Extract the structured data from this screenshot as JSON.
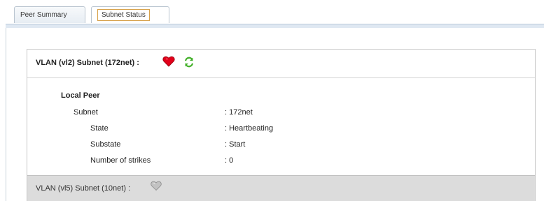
{
  "tabs": {
    "peer_summary": "Peer Summary",
    "subnet_status": "Subnet Status"
  },
  "vlan1": {
    "title": "VLAN (vl2) Subnet (172net) :",
    "status_icon": "heart-red-icon",
    "refresh_icon": "refresh-green-icon",
    "section_title": "Local Peer",
    "rows": [
      {
        "label": "Subnet",
        "value": ": 172net"
      },
      {
        "label": "State",
        "value": ": Heartbeating"
      },
      {
        "label": "Substate",
        "value": ": Start"
      },
      {
        "label": "Number of strikes",
        "value": ": 0"
      }
    ]
  },
  "vlan2": {
    "title": "VLAN (vl5) Subnet (10net) :",
    "status_icon": "heart-grey-icon"
  },
  "colors": {
    "active_heart": "#e2001a",
    "inactive_heart": "#c2c2c2",
    "refresh": "#43b02a",
    "footer_bg": "#dcdcdc"
  }
}
